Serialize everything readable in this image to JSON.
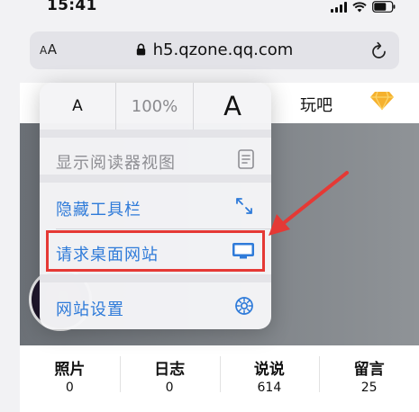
{
  "status_bar": {
    "time": "15:41"
  },
  "url_bar": {
    "aa_small": "A",
    "aa_large": "A",
    "url": "h5.qzone.qq.com"
  },
  "page": {
    "nav_item": "玩吧",
    "stats": [
      {
        "label": "照片",
        "value": "0"
      },
      {
        "label": "日志",
        "value": "0"
      },
      {
        "label": "说说",
        "value": "614"
      },
      {
        "label": "留言",
        "value": "25"
      }
    ]
  },
  "menu": {
    "zoom_smaller": "A",
    "zoom_level": "100%",
    "zoom_larger": "A",
    "items": [
      {
        "label": "显示阅读器视图",
        "icon": "reader-view-icon",
        "enabled": false
      },
      {
        "label": "隐藏工具栏",
        "icon": "expand-arrows-icon",
        "enabled": true
      },
      {
        "label": "请求桌面网站",
        "icon": "desktop-monitor-icon",
        "enabled": true
      },
      {
        "label": "网站设置",
        "icon": "settings-gear-icon",
        "enabled": true
      }
    ]
  },
  "colors": {
    "accent": "#2f7bd9",
    "highlight": "#e53935",
    "disabled": "#8e8e93"
  }
}
